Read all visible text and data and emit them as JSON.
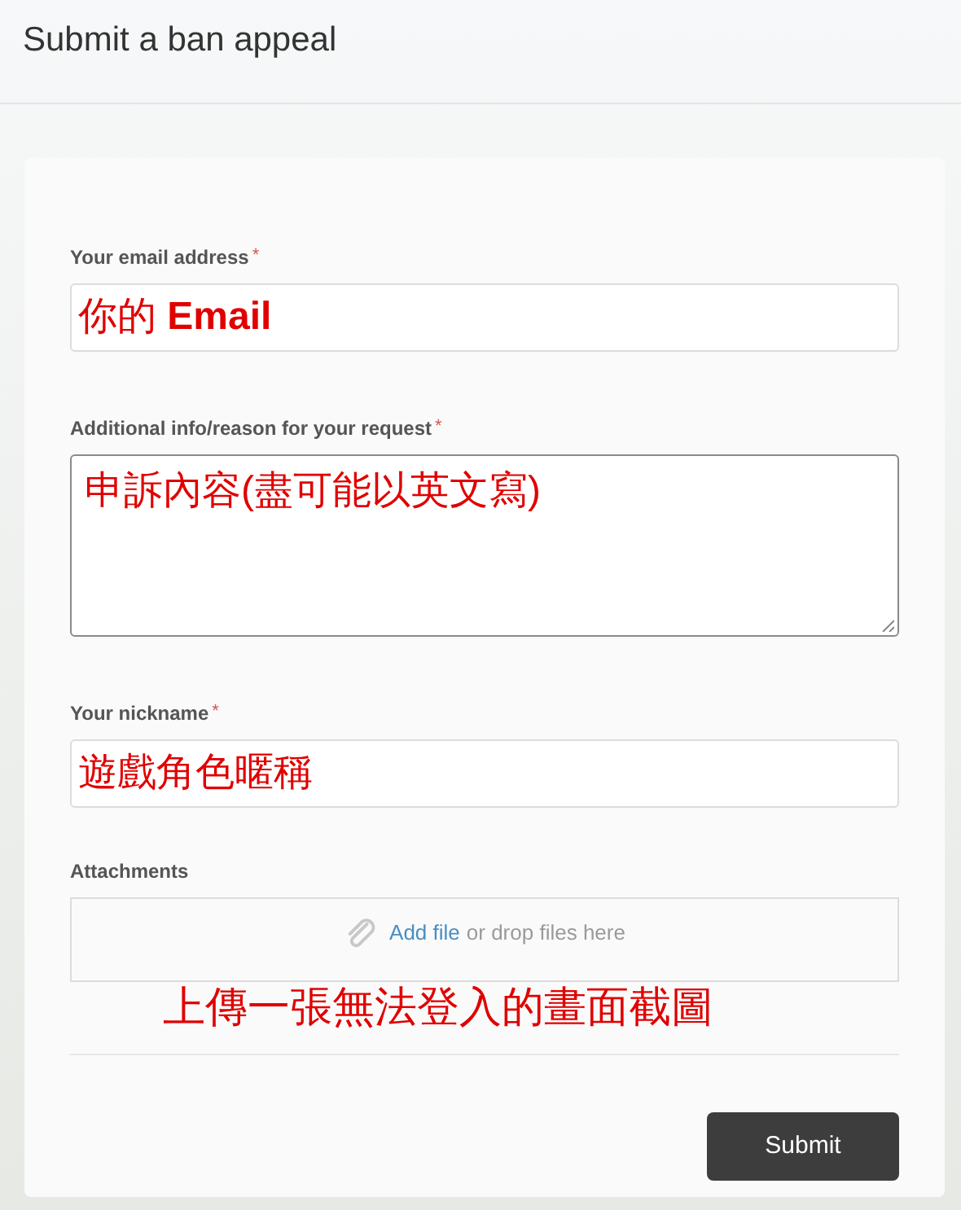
{
  "header": {
    "title": "Submit a ban appeal"
  },
  "form": {
    "fields": [
      {
        "kind": "input",
        "label": "Your email address",
        "required_mark": "*",
        "value": "你的 **Email**"
      },
      {
        "kind": "textarea",
        "label": "Additional info/reason for your request",
        "required_mark": "*",
        "value": "申訴內容(盡可能以英文寫)"
      },
      {
        "kind": "input",
        "label": "Your nickname",
        "required_mark": "*",
        "value": "遊戲角色暱稱"
      },
      {
        "kind": "attachments",
        "label": "Attachments",
        "link": "Add file",
        "hint": "or drop files here",
        "annotation": "上傳一張無法登入的畫面截圖"
      }
    ],
    "submit": "Submit"
  }
}
